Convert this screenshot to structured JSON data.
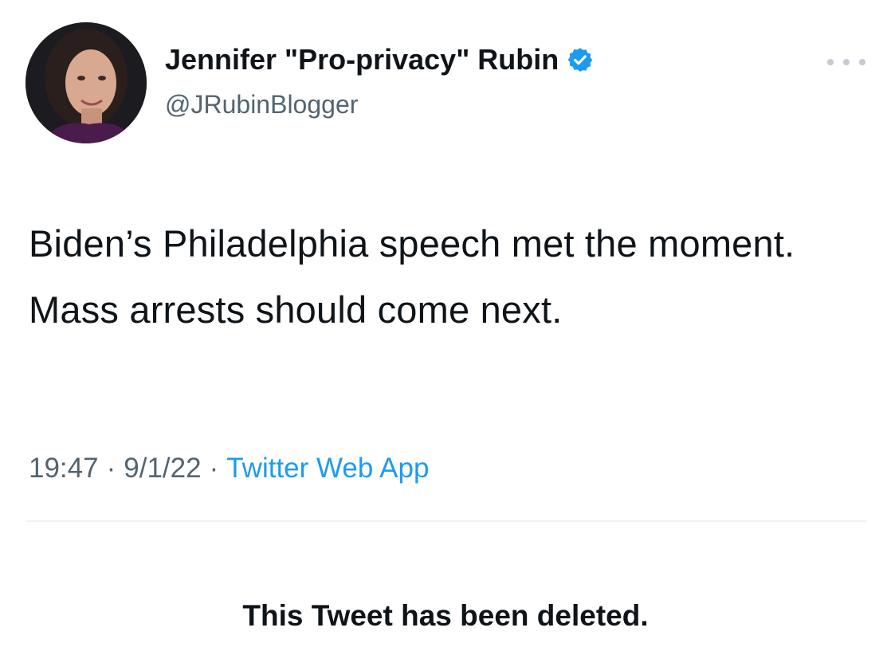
{
  "tweet": {
    "author": {
      "display_name": "Jennifer \"Pro-privacy\" Rubin",
      "handle": "@JRubinBlogger",
      "verified_icon": "verified-badge-icon"
    },
    "text": "Biden’s Philadelphia speech met the moment.  Mass arrests should come next.",
    "meta": {
      "time": "19:47",
      "separator": "·",
      "date": "9/1/22",
      "source": "Twitter Web App"
    },
    "notice": "This Tweet has been deleted."
  },
  "colors": {
    "text": "#0f1419",
    "secondary": "#536471",
    "accent": "#1d9bf0",
    "divider": "#eff3f4"
  }
}
